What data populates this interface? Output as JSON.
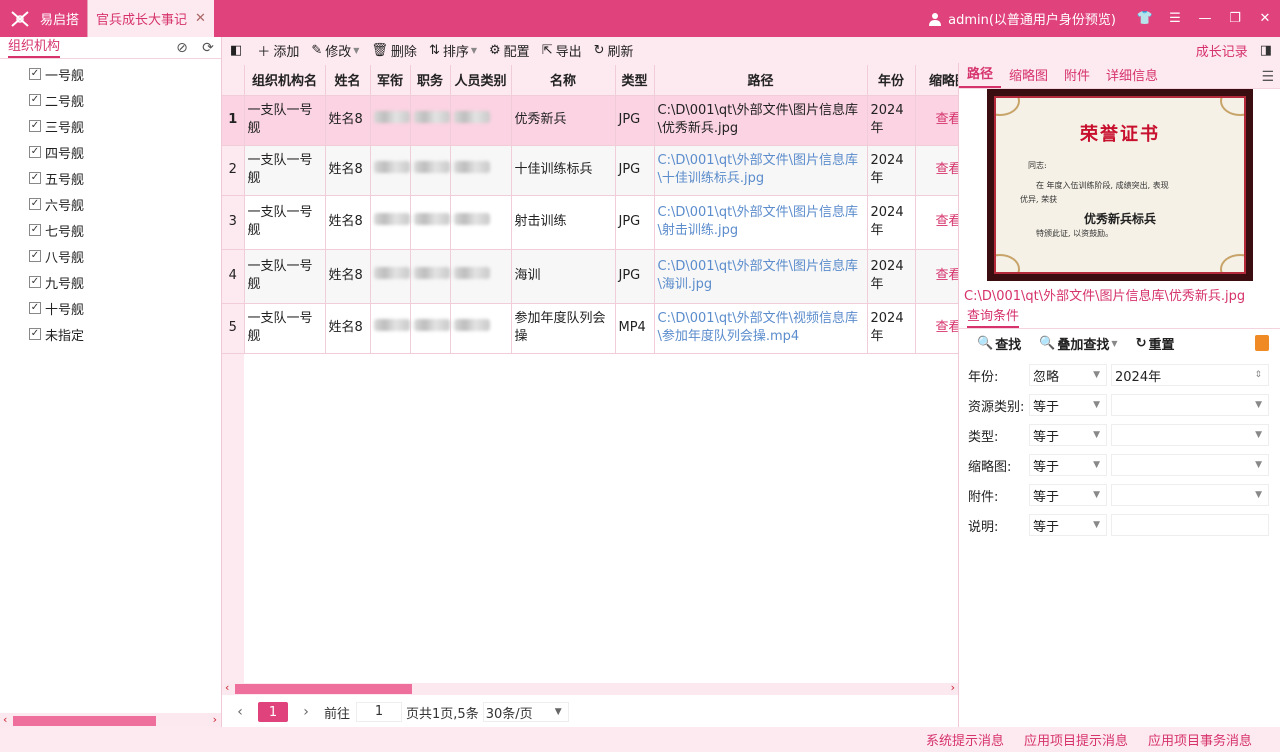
{
  "app": {
    "name": "易启搭",
    "active_tab": "官兵成长大事记"
  },
  "user": {
    "label": "admin(以普通用户身份预览)"
  },
  "left": {
    "title": "组织机构",
    "items": [
      "一号舰",
      "二号舰",
      "三号舰",
      "四号舰",
      "五号舰",
      "六号舰",
      "七号舰",
      "八号舰",
      "九号舰",
      "十号舰",
      "未指定"
    ]
  },
  "toolbar": {
    "add": "添加",
    "edit": "修改",
    "delete": "删除",
    "sort": "排序",
    "config": "配置",
    "export": "导出",
    "refresh": "刷新",
    "growth": "成长记录"
  },
  "table": {
    "headers": [
      "组织机构名",
      "姓名",
      "军衔",
      "职务",
      "人员类别",
      "名称",
      "类型",
      "路径",
      "年份",
      "缩略图"
    ],
    "rows": [
      {
        "num": "1",
        "org": "一支队一号舰",
        "name": "姓名8",
        "title": "优秀新兵",
        "type": "JPG",
        "path": "C:\\D\\001\\qt\\外部文件\\图片信息库\\优秀新兵.jpg",
        "year": "2024年",
        "view": "查看"
      },
      {
        "num": "2",
        "org": "一支队一号舰",
        "name": "姓名8",
        "title": "十佳训练标兵",
        "type": "JPG",
        "path": "C:\\D\\001\\qt\\外部文件\\图片信息库\\十佳训练标兵.jpg",
        "year": "2024年",
        "view": "查看"
      },
      {
        "num": "3",
        "org": "一支队一号舰",
        "name": "姓名8",
        "title": "射击训练",
        "type": "JPG",
        "path": "C:\\D\\001\\qt\\外部文件\\图片信息库\\射击训练.jpg",
        "year": "2024年",
        "view": "查看"
      },
      {
        "num": "4",
        "org": "一支队一号舰",
        "name": "姓名8",
        "title": "海训",
        "type": "JPG",
        "path": "C:\\D\\001\\qt\\外部文件\\图片信息库\\海训.jpg",
        "year": "2024年",
        "view": "查看"
      },
      {
        "num": "5",
        "org": "一支队一号舰",
        "name": "姓名8",
        "title": "参加年度队列会操",
        "type": "MP4",
        "path": "C:\\D\\001\\qt\\外部文件\\视频信息库\\参加年度队列会操.mp4",
        "year": "2024年",
        "view": "查看"
      }
    ]
  },
  "pager": {
    "current": "1",
    "goto_label": "前往",
    "goto_value": "1",
    "summary": "页共1页,5条",
    "page_size": "30条/页"
  },
  "detail": {
    "tabs": [
      "路径",
      "缩略图",
      "附件",
      "详细信息"
    ],
    "cert_title": "荣誉证书",
    "cert_greet": "同志:",
    "cert_line1": "在      年度入伍训练阶段, 成绩突出, 表现",
    "cert_line2": "优异, 荣获",
    "cert_award": "优秀新兵标兵",
    "cert_line3": "特颁此证, 以资鼓励。",
    "path": "C:\\D\\001\\qt\\外部文件\\图片信息库\\优秀新兵.jpg",
    "query_tab": "查询条件",
    "find": "查找",
    "add_find": "叠加查找",
    "reset": "重置",
    "filters": [
      {
        "label": "年份:",
        "op": "忽略",
        "value": "2024年"
      },
      {
        "label": "资源类别:",
        "op": "等于",
        "value": ""
      },
      {
        "label": "类型:",
        "op": "等于",
        "value": ""
      },
      {
        "label": "缩略图:",
        "op": "等于",
        "value": ""
      },
      {
        "label": "附件:",
        "op": "等于",
        "value": ""
      },
      {
        "label": "说明:",
        "op": "等于",
        "value": ""
      }
    ]
  },
  "status": {
    "sys": "系统提示消息",
    "proj_tip": "应用项目提示消息",
    "proj_task": "应用项目事务消息"
  },
  "colors": {
    "accent": "#e0427c",
    "accent_text": "#d6336c",
    "light": "#fde9f0"
  }
}
